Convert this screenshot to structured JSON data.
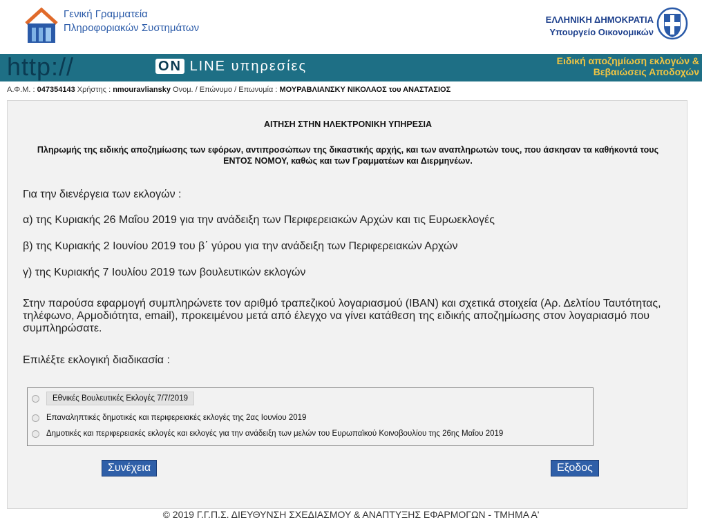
{
  "header": {
    "gsis_line1": "Γενική Γραμματεία",
    "gsis_line2": "Πληροφοριακών Συστημάτων",
    "gr_line1": "ΕΛΛΗΝΙΚΗ ΔΗΜΟΚΡΑΤΙΑ",
    "gr_line2": "Υπουργείο Οικονομικών"
  },
  "banner": {
    "http": "http://",
    "online_on": "ON",
    "online_rest": "LINE υπηρεσίες",
    "right_line1": "Ειδική αποζημίωση εκλογών &",
    "right_line2": "Βεβαιώσεις Αποδοχών"
  },
  "userbar": {
    "afm_label": "Α.Φ.Μ. :",
    "afm_value": "047354143",
    "user_label": "Χρήστης :",
    "user_value": "nmouravliansky",
    "name_label": "Ονομ. / Επώνυμο / Επωνυμία :",
    "name_value": "ΜΟΥΡΑΒΛΙΑΝΣΚΥ  ΝΙΚΟΛΑΟΣ του ΑΝΑΣΤΑΣΙΟΣ"
  },
  "main": {
    "title": "ΑΙΤΗΣΗ ΣΤΗΝ ΗΛΕΚΤΡΟΝΙΚΗ ΥΠΗΡΕΣΙΑ",
    "subtitle": "Πληρωμής της ειδικής αποζημίωσης των εφόρων, αντιπροσώπων της δικαστικής αρχής, και των αναπληρωτών τους, που άσκησαν τα καθήκοντά τους ΕΝΤΟΣ ΝΟΜΟΥ, καθώς και των Γραμματέων και Διερμηνέων.",
    "intro": "Για την διενέργεια των εκλογών :",
    "item_a": "α) της Κυριακής 26 Μαΐου 2019 για την ανάδειξη των Περιφερειακών Αρχών και τις Ευρωεκλογές",
    "item_b": "β) της Κυριακής 2 Ιουνίου 2019 του β΄ γύρου για την ανάδειξη των Περιφερειακών Αρχών",
    "item_c": "γ) της Κυριακής 7 Ιουλίου 2019 των βουλευτικών εκλογών",
    "description": "Στην παρούσα εφαρμογή συμπληρώνετε τον αριθμό τραπεζικού λογαριασμού (IBAN) και σχετικά στοιχεία (Αρ. Δελτίου Ταυτότητας, τηλέφωνο, Αρμοδιότητα, email), προκειμένου μετά από έλεγχο να γίνει κατάθεση της ειδικής αποζημίωσης στον λογαριασμό που συμπληρώσατε.",
    "choose": "Επιλέξτε εκλογική διαδικασία :",
    "options": [
      "Εθνικές Βουλευτικές Εκλογές 7/7/2019",
      "Επαναληπτικές δημοτικές και περιφερειακές εκλογές της 2ας Ιουνίου 2019",
      "Δημοτικές και περιφερειακές εκλογές και εκλογές για την ανάδειξη των μελών του Ευρωπαϊκού Κοινοβουλίου της 26ης Μαΐου 2019"
    ],
    "continue_label": "Συνέχεια",
    "exit_label": "Εξοδος"
  },
  "footer": {
    "text": "© 2019 Γ.Γ.Π.Σ. ΔΙΕΥΘΥΝΣΗ ΣΧΕΔΙΑΣΜΟΥ & ΑΝΑΠΤΥΞΗΣ ΕΦΑΡΜΟΓΩΝ - ΤΜΗΜΑ Α'"
  },
  "colors": {
    "banner_bg": "#1e6f85",
    "banner_accent": "#f2c542",
    "brand_blue": "#2a5aa8",
    "button_bg": "#2f5fa8"
  }
}
